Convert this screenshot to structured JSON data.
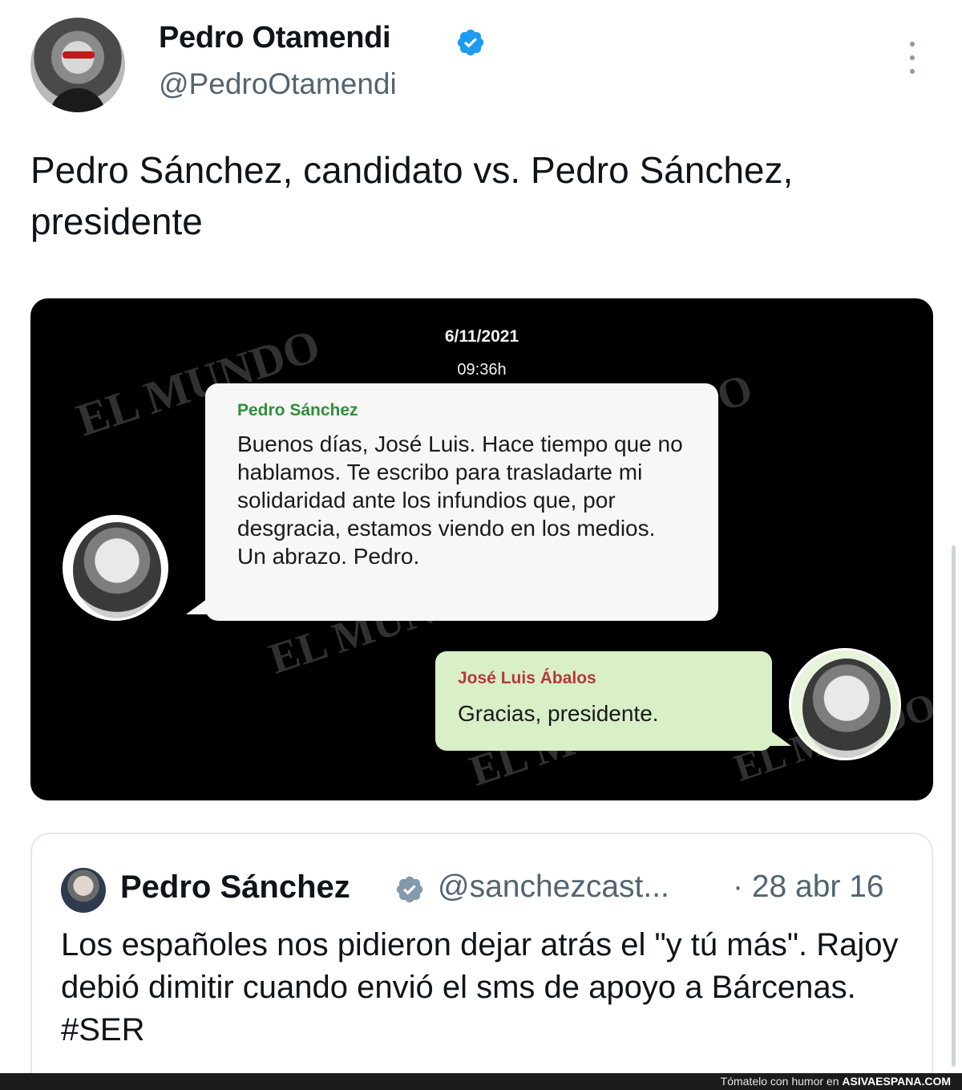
{
  "author": {
    "name": "Pedro Otamendi",
    "handle": "@PedroOtamendi"
  },
  "tweet": {
    "text": "Pedro Sánchez, candidato vs. Pedro Sánchez, presidente"
  },
  "media": {
    "watermark": "EL MUNDO",
    "date": "6/11/2021",
    "time": "09:36h",
    "message1": {
      "sender": "Pedro Sánchez",
      "text": "Buenos días, José Luis. Hace tiempo que no hablamos. Te escribo para trasladarte mi solidaridad ante los infundios que, por desgracia, estamos viendo en los medios. Un abrazo. Pedro."
    },
    "message2": {
      "sender": "José Luis Ábalos",
      "text": "Gracias, presidente."
    }
  },
  "quoted": {
    "name": "Pedro Sánchez",
    "handle": "@sanchezcast...",
    "date": "· 28 abr 16",
    "text": "Los españoles nos pidieron dejar atrás el \"y tú más\". Rajoy debió dimitir cuando envió el sms de apoyo a Bárcenas. #SER"
  },
  "footer": {
    "text": "Tómatelo con humor en",
    "site": "ASIVAESPANA.COM"
  },
  "colors": {
    "verified": "#1d9bf0",
    "secondary_text": "#536471",
    "bubble_in": "#f7f7f7",
    "bubble_out": "#d9efc8"
  }
}
